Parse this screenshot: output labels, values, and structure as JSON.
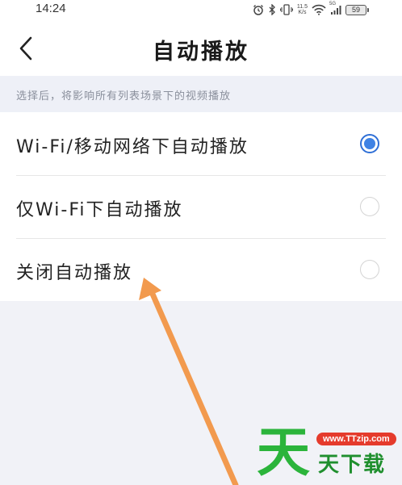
{
  "status_bar": {
    "time": "14:24",
    "net_speed_value": "11.5",
    "net_speed_unit": "K/s",
    "signal_label": "5G",
    "battery": "59"
  },
  "header": {
    "title": "自动播放"
  },
  "hint": "选择后，将影响所有列表场景下的视频播放",
  "options": [
    {
      "label": "Wi-Fi/移动网络下自动播放",
      "selected": true
    },
    {
      "label": "仅Wi-Fi下自动播放",
      "selected": false
    },
    {
      "label": "关闭自动播放",
      "selected": false
    }
  ],
  "annotation": {
    "arrow_color": "#f29a4e"
  },
  "watermark": {
    "big_char": "天",
    "url": "www.TTzip.com",
    "text": "天下载"
  }
}
